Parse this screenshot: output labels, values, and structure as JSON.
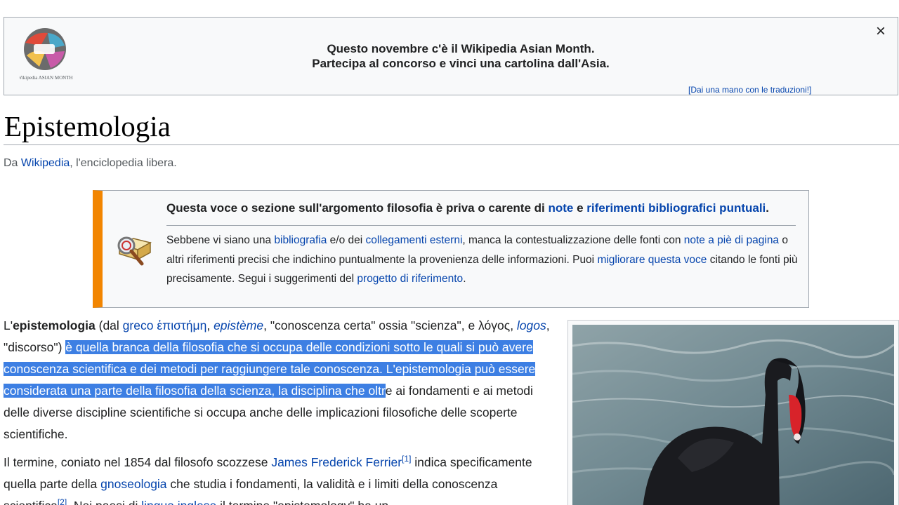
{
  "banner": {
    "logo_text": "Wikipedia ASIAN MONTH",
    "line1": "Questo novembre c'è il Wikipedia Asian Month.",
    "line2": "Partecipa al concorso e vinci una cartolina dall'Asia.",
    "help_link": "[Dai una mano con le traduzioni!]",
    "close_label": "×"
  },
  "page": {
    "title": "Epistemologia",
    "tagline_prefix": "Da ",
    "tagline_link": "Wikipedia",
    "tagline_suffix": ", l'enciclopedia libera."
  },
  "ambox": {
    "main_1": "Questa voce o sezione sull'argomento filosofia è priva o carente di ",
    "main_link_1": "note",
    "main_2": " e ",
    "main_link_2": "riferimenti bibliografici puntuali",
    "main_3": ".",
    "sub_1": "Sebbene vi siano una ",
    "sub_link_1": "bibliografia",
    "sub_2": " e/o dei ",
    "sub_link_2": "collegamenti esterni",
    "sub_3": ", manca la contestualizzazione delle fonti con ",
    "sub_link_3": "note a piè di pagina",
    "sub_4": " o altri riferimenti precisi che indichino puntualmente la provenienza delle informazioni. Puoi ",
    "sub_link_4": "migliorare questa voce",
    "sub_5": " citando le fonti più precisamente. Segui i suggerimenti del ",
    "sub_link_5": "progetto di riferimento",
    "sub_6": "."
  },
  "para1": {
    "t1": "L'",
    "bold": "epistemologia",
    "t2": " (dal ",
    "link_greco": "greco",
    "t3": " ",
    "link_greek_word": "ἐπιστήμη",
    "t4": ", ",
    "link_episteme": "epistème",
    "t5": ", \"conoscenza certa\" ossia \"scienza\", e λόγος, ",
    "link_logos": "logos",
    "t6": ", \"discorso\") ",
    "selected": "è quella branca della filosofia che si occupa delle condizioni sotto le quali si può avere conoscenza scientifica e dei metodi per raggiungere tale conoscenza. L'epistemologia può essere considerata una parte della filosofia della scienza, la disciplina che oltr",
    "t7": "e ai fondamenti e ai metodi delle diverse discipline scientifiche si occupa anche delle implicazioni filosofiche delle scoperte scientifiche."
  },
  "para2": {
    "t1": "Il termine, coniato nel 1854 dal filosofo scozzese ",
    "link_ferrier": "James Frederick Ferrier",
    "ref1": "[1]",
    "t2": " indica specificamente quella parte della ",
    "link_gnoseologia": "gnoseologia",
    "t3": " che studia i fondamenti, la validità e i limiti della conoscenza scientifica",
    "ref2": "[2]",
    "t4": ". Nei paesi di ",
    "link_lingua": "lingua inglese",
    "t5": " il termine \"epistemology\" ha un"
  },
  "image": {
    "alt": "black-swan-photo"
  }
}
